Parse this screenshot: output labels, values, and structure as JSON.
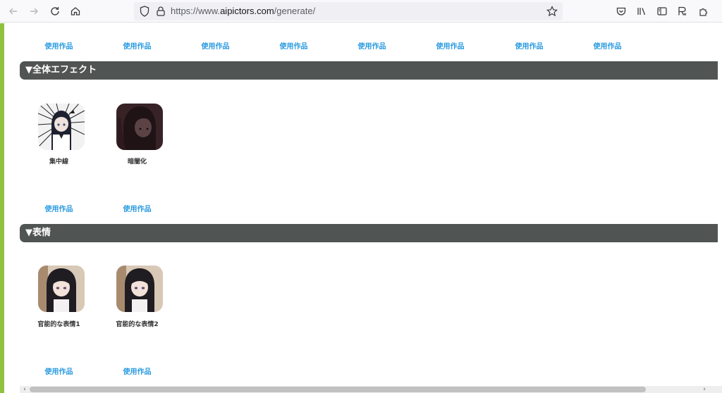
{
  "browser": {
    "url_prefix": "https://www.",
    "url_domain": "aipictors.com",
    "url_path": "/generate/"
  },
  "use_label": "使用作品",
  "sections": [
    {
      "title": "▼全体エフェクト",
      "items": [
        {
          "label": "集中線"
        },
        {
          "label": "暗闇化"
        }
      ]
    },
    {
      "title": "▼表情",
      "items": [
        {
          "label": "官能的な表情1"
        },
        {
          "label": "官能的な表情2"
        }
      ]
    }
  ]
}
